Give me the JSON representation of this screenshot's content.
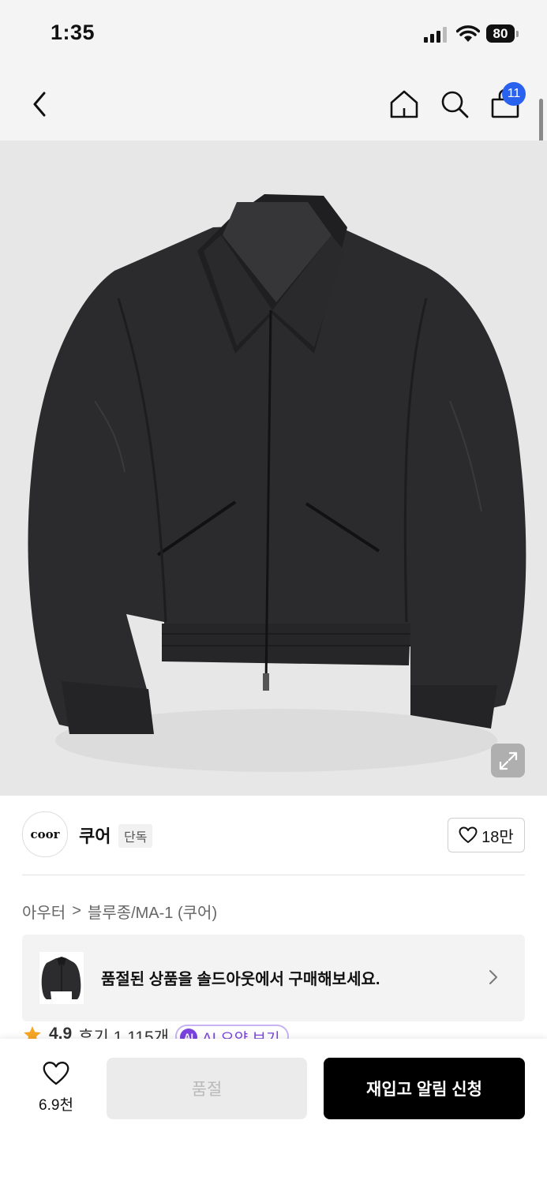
{
  "status_bar": {
    "time": "1:35",
    "battery": "80"
  },
  "header": {
    "cart_count": "11"
  },
  "brand": {
    "logo_text": "coor",
    "name": "쿠어",
    "tag": "단독",
    "likes": "18만"
  },
  "breadcrumb": {
    "category": "아우터",
    "separator": ">",
    "subcategory": "블루종/MA-1 (쿠어)"
  },
  "soldout_banner": {
    "text": "품절된 상품을 솔드아웃에서 구매해보세요."
  },
  "rating": {
    "score": "4.9",
    "reviews": "후기 1,115개",
    "ai_badge": "AI",
    "ai_label": "AI 요약 보기"
  },
  "bottom_bar": {
    "wishlist_count": "6.9천",
    "soldout_label": "품절",
    "restock_label": "재입고 알림 신청"
  }
}
